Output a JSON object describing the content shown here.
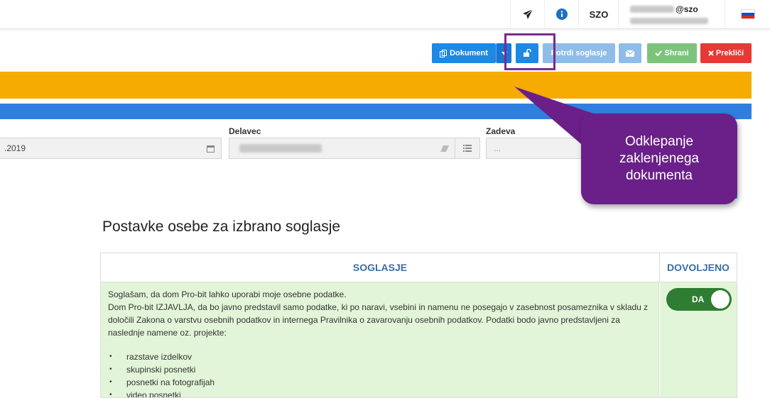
{
  "topbar": {
    "org": "SZO",
    "user_suffix": "@szo",
    "icons": {
      "send": "paper-plane-icon",
      "info": "info-circle-icon",
      "flag": "slovenia-flag-icon"
    }
  },
  "toolbar": {
    "document_label": "Dokument",
    "confirm_label": "Potrdi soglasje",
    "save_label": "Shrani",
    "cancel_label": "Prekliči",
    "colors": {
      "primary": "#1e88e5",
      "save": "#7cc47c",
      "cancel": "#e53935",
      "disabled": "#8fbde9"
    }
  },
  "bands": {
    "orange": "#f5ab00",
    "blue": "#2f7fe0"
  },
  "form": {
    "date_value": ".2019",
    "worker_label": "Delavec",
    "subject_label": "Zadeva",
    "subject_placeholder": "..."
  },
  "section": {
    "title": "Postavke osebe za izbrano soglasje"
  },
  "table": {
    "headers": {
      "consent": "SOGLASJE",
      "allowed": "DOVOLJENO"
    },
    "row": {
      "text_line1": "Soglašam, da dom Pro-bit lahko uporabi moje osebne podatke.",
      "text_paragraph": "Dom Pro-bit IZJAVLJA, da bo javno predstavil samo podatke, ki po naravi, vsebini in namenu ne posegajo v zasebnost posameznika v skladu z določili Zakona o varstvu osebnih podatkov in internega Pravilnika o zavarovanju osebnih podatkov. Podatki bodo javno predstavljeni za naslednje namene oz. projekte:",
      "items": [
        "razstave izdelkov",
        "skupinski posnetki",
        "posnetki na fotografijah",
        "video posnetki"
      ],
      "toggle_label": "DA",
      "toggle_color": "#2e7d32"
    }
  },
  "callout": {
    "lines": [
      "Odklepanje",
      "zaklenjenega",
      "dokumenta"
    ],
    "color": "#6a2088"
  }
}
